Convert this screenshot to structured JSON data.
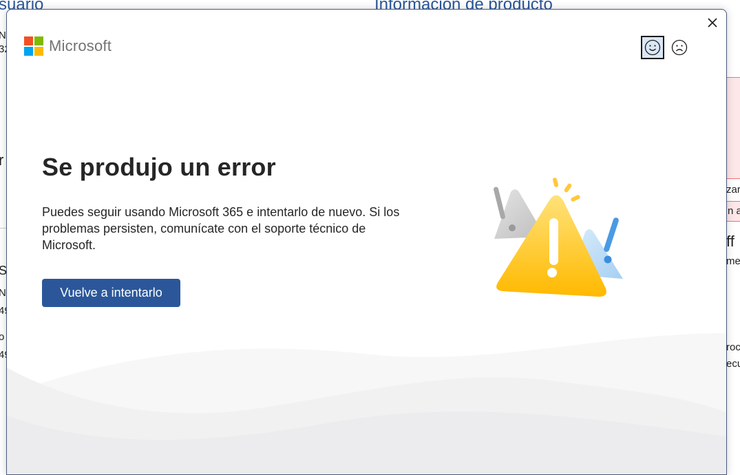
{
  "background": {
    "left_heading": "suario",
    "right_heading": "Información de producto",
    "fragments": [
      "NI",
      "32",
      "r",
      "S",
      "N",
      "49",
      "o",
      "49",
      "zar",
      "n ac",
      "ff",
      "me",
      "roc",
      "ecu"
    ]
  },
  "dialog": {
    "brand": "Microsoft",
    "brand_colors": [
      "#f25022",
      "#7fba00",
      "#00a4ef",
      "#ffb900"
    ],
    "title": "Se produjo un error",
    "message": "Puedes seguir usando Microsoft 365 e intentarlo de nuevo. Si los problemas persisten, comunícate con el soporte técnico de Microsoft.",
    "retry_label": "Vuelve a intentarlo",
    "accent_color": "#2b579a",
    "icons": {
      "close": "close-icon",
      "feedback_positive": "smile-icon",
      "feedback_negative": "frown-icon",
      "illustration": "warning-triangle-illustration"
    }
  }
}
